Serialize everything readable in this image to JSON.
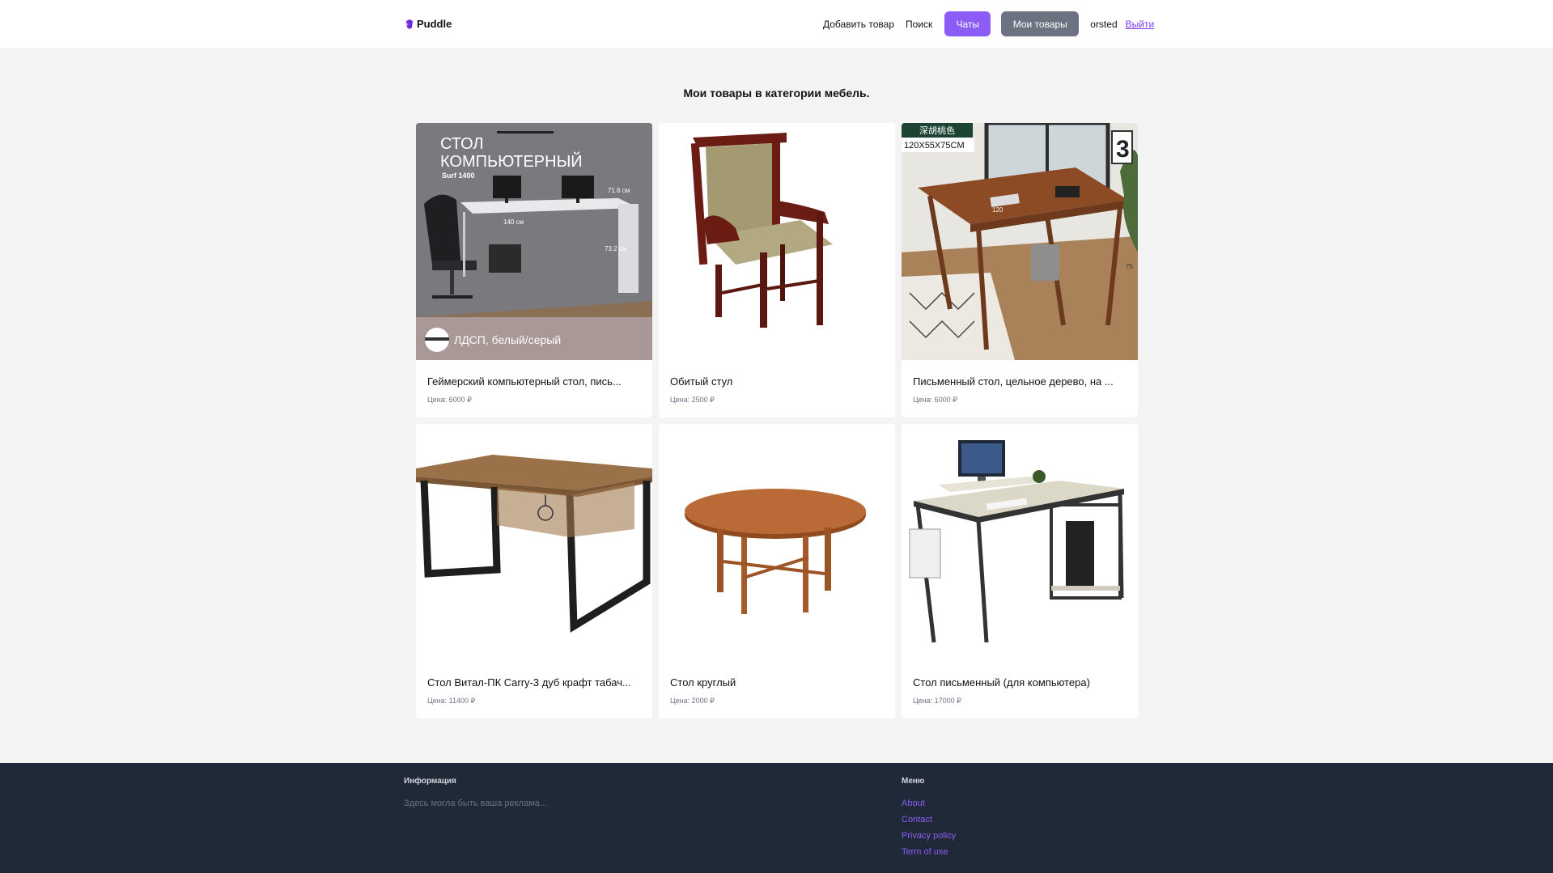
{
  "header": {
    "logo_text": "Puddle",
    "nav": {
      "add_item": "Добавить товар",
      "search": "Поиск",
      "chats": "Чаты",
      "my_items": "Мои товары",
      "username": "orsted",
      "logout": "Выйти"
    }
  },
  "main": {
    "title": "Мои товары в категории мебель.",
    "items": [
      {
        "title": "Геймерский компьютерный стол, пись...",
        "price": "Цена: 6000 ₽",
        "image_text": {
          "heading_1": "СТОЛ",
          "heading_2": "КОМПЬЮТЕРНЫЙ",
          "model": "Surf 1400",
          "dim_width": "140 см",
          "dim_depth": "71.6 см",
          "dim_height": "73.2 см",
          "material": "ЛДСП, белый/серый"
        }
      },
      {
        "title": "Обитый стул",
        "price": "Цена: 2500 ₽"
      },
      {
        "title": "Письменный стол, цельное дерево, на ...",
        "price": "Цена: 6000 ₽",
        "image_text": {
          "badge": "深胡桃色",
          "size": "120X55X75CM",
          "dim_120": "120",
          "dim_55": "55",
          "dim_75": "75",
          "wall_number": "3"
        }
      },
      {
        "title": "Стол Витал-ПК Carry-3 дуб крафт табач...",
        "price": "Цена: 11400 ₽"
      },
      {
        "title": "Стол круглый",
        "price": "Цена: 2000 ₽"
      },
      {
        "title": "Стол письменный (для компьютера)",
        "price": "Цена: 17000 ₽"
      }
    ]
  },
  "footer": {
    "info_heading": "Информация",
    "info_text": "Здесь могла быть ваша реклама...",
    "menu_heading": "Меню",
    "links": [
      "About",
      "Contact",
      "Privacy policy",
      "Term of use"
    ]
  },
  "colors": {
    "accent": "#8b5cf6",
    "secondary_button": "#6b7280",
    "footer_bg": "#1f2937",
    "page_bg": "#f4f4f5"
  }
}
